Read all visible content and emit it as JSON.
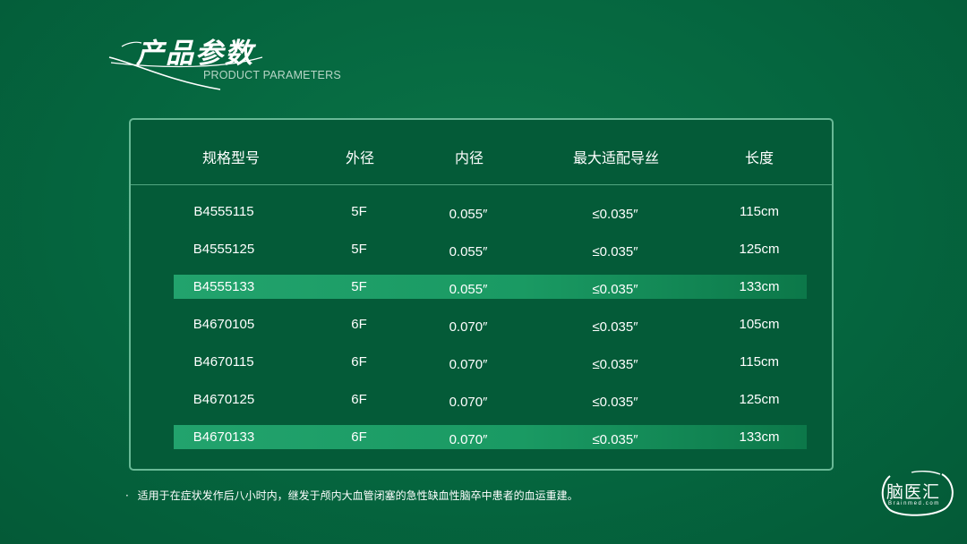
{
  "header": {
    "title": "产品参数",
    "subtitle": "PRODUCT PARAMETERS"
  },
  "table": {
    "columns": [
      "规格型号",
      "外径",
      "内径",
      "最大适配导丝",
      "长度"
    ],
    "rows": [
      {
        "model": "B4555115",
        "od": "5F",
        "id": "0.055″",
        "guidewire": "≤0.035″",
        "length": "115cm",
        "highlight": false
      },
      {
        "model": "B4555125",
        "od": "5F",
        "id": "0.055″",
        "guidewire": "≤0.035″",
        "length": "125cm",
        "highlight": false
      },
      {
        "model": "B4555133",
        "od": "5F",
        "id": "0.055″",
        "guidewire": "≤0.035″",
        "length": "133cm",
        "highlight": true
      },
      {
        "model": "B4670105",
        "od": "6F",
        "id": "0.070″",
        "guidewire": "≤0.035″",
        "length": "105cm",
        "highlight": false
      },
      {
        "model": "B4670115",
        "od": "6F",
        "id": "0.070″",
        "guidewire": "≤0.035″",
        "length": "115cm",
        "highlight": false
      },
      {
        "model": "B4670125",
        "od": "6F",
        "id": "0.070″",
        "guidewire": "≤0.035″",
        "length": "125cm",
        "highlight": false
      },
      {
        "model": "B4670133",
        "od": "6F",
        "id": "0.070″",
        "guidewire": "≤0.035″",
        "length": "133cm",
        "highlight": true
      }
    ]
  },
  "note": {
    "bullet": "·",
    "text": "适用于在症状发作后八小时内，继发于颅内大血管闭塞的急性缺血性脑卒中患者的血运重建。"
  },
  "watermark": {
    "main": "脑医汇",
    "sub": "Brainmed.com"
  },
  "colors": {
    "background": "#05663f",
    "panel_border": "#69b996",
    "highlight_row": "#1a9a63"
  }
}
